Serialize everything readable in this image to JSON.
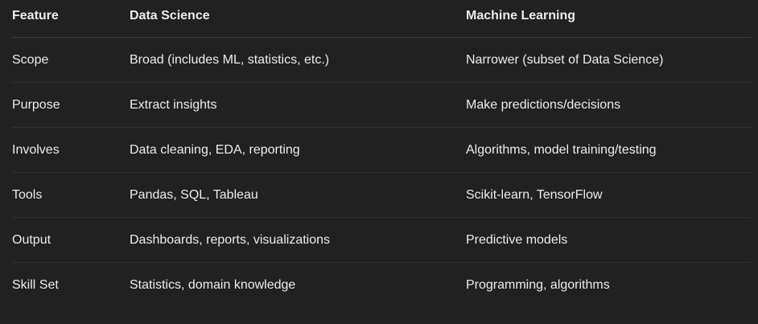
{
  "table": {
    "headers": [
      "Feature",
      "Data Science",
      "Machine Learning"
    ],
    "rows": [
      [
        "Scope",
        "Broad (includes ML, statistics, etc.)",
        "Narrower (subset of Data Science)"
      ],
      [
        "Purpose",
        "Extract insights",
        "Make predictions/decisions"
      ],
      [
        "Involves",
        "Data cleaning, EDA, reporting",
        "Algorithms, model training/testing"
      ],
      [
        "Tools",
        "Pandas, SQL, Tableau",
        "Scikit-learn, TensorFlow"
      ],
      [
        "Output",
        "Dashboards, reports, visualizations",
        "Predictive models"
      ],
      [
        "Skill Set",
        "Statistics, domain knowledge",
        "Programming, algorithms"
      ]
    ]
  }
}
